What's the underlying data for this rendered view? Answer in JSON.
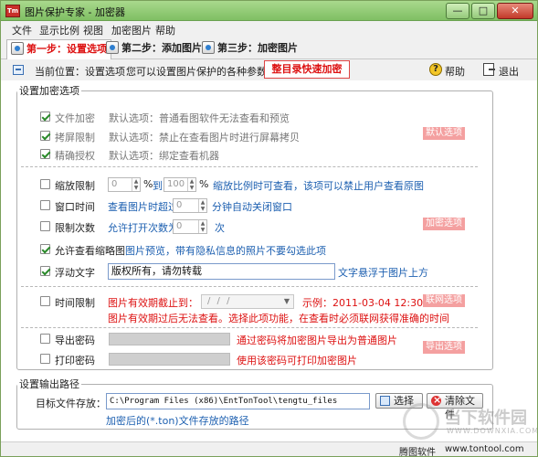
{
  "window": {
    "title": "图片保护专家 - 加密器",
    "app_icon_text": "Tm"
  },
  "titlebar_buttons": {
    "minimize": "—",
    "maximize": "□",
    "close": "✕"
  },
  "menu": [
    "文件",
    "显示比例",
    "视图",
    "加密图片",
    "帮助"
  ],
  "steps": [
    {
      "label": "第一步：设置选项",
      "active": true
    },
    {
      "label": "第二步：添加图片",
      "active": false
    },
    {
      "label": "第三步：加密图片",
      "active": false
    }
  ],
  "toolbar": {
    "position": "当前位置：设置选项",
    "description": "您可以设置图片保护的各种参数",
    "catalog_button": "整目录快速加密",
    "help": "帮助",
    "help_icon": "?",
    "exit": "退出"
  },
  "options_group": {
    "legend": "设置加密选项",
    "default_options": [
      {
        "label": "文件加密",
        "checked": true,
        "hint": "默认选项：普通看图软件无法查看和预览"
      },
      {
        "label": "拷屏限制",
        "checked": true,
        "hint": "默认选项：禁止在查看图片时进行屏幕拷贝"
      },
      {
        "label": "精确授权",
        "checked": true,
        "hint": "默认选项：绑定查看机器"
      }
    ],
    "default_badge": "默认选项",
    "zoom": {
      "label": "缩放限制",
      "checked": false,
      "from": "0",
      "percent1": "%",
      "to_word": "到",
      "to": "100",
      "percent2": "%",
      "hint": "缩放比例时可查看，该项可以禁止用户查看原图"
    },
    "window_time": {
      "label": "窗口时间",
      "checked": false,
      "prefix": "查看图片时超过",
      "value": "0",
      "suffix": "分钟自动关闭窗口"
    },
    "open_limit": {
      "label": "限制次数",
      "checked": false,
      "prefix": "允许打开次数为",
      "value": "0",
      "suffix": "次"
    },
    "encrypt_badge": "加密选项",
    "thumbnail": {
      "label": "允许查看缩略图",
      "checked": true,
      "hint": "图片预览，带有隐私信息的照片不要勾选此项"
    },
    "watermark_text": {
      "label": "浮动文字",
      "checked": true,
      "value": "版权所有，请勿转载",
      "hint": "文字悬浮于图片上方"
    },
    "time_limit": {
      "label": "时间限制",
      "checked": false,
      "prefix": "图片有效期截止到：",
      "date": "/ / /",
      "example": "示例：2011-03-04 12:30:00",
      "note": "图片有效期过后无法查看。选择此项功能，在查看时必须联网获得准确的时间"
    },
    "network_badge": "联网选项",
    "export_password": {
      "label": "导出密码",
      "checked": false,
      "hint": "通过密码将加密图片导出为普通图片"
    },
    "print_password": {
      "label": "打印密码",
      "checked": false,
      "hint": "使用该密码可打印加密图片"
    },
    "export_badge": "导出选项"
  },
  "output_group": {
    "legend": "设置输出路径",
    "label": "目标文件存放：",
    "path": "C:\\Program Files (x86)\\EntTonTool\\tengtu_files",
    "select_button": "选择",
    "clear_button": "清除文件",
    "note": "加密后的(*.ton)文件存放的路径"
  },
  "status": {
    "vendor": "腾图软件",
    "url": "www.tontool.com"
  },
  "watermark": {
    "text": "当下软件园",
    "url": "WWW.DOWNXIA.COM"
  },
  "colors": {
    "accent_red": "#dd1111",
    "badge_pink": "#f4a0a0",
    "link_blue": "#1c5fb0",
    "title_green": "#8fcb6f"
  }
}
